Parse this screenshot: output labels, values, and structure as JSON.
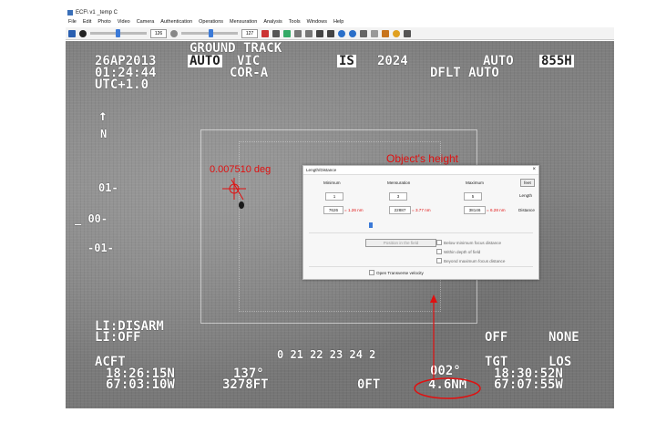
{
  "titlebar": {
    "title": "ECF\\ v1 _temp C"
  },
  "menu": [
    "File",
    "Edit",
    "Photo",
    "Video",
    "Camera",
    "Authentication",
    "Operations",
    "Mensuration",
    "Analysis",
    "Tools",
    "Windows",
    "Help"
  ],
  "toolbar": {
    "value_a": "126",
    "value_b": "127"
  },
  "hud": {
    "mode": "GROUND TRACK",
    "date": "26AP2013",
    "auto_box": "AUTO",
    "vic": "VIC",
    "corr": "COR-A",
    "is": "IS",
    "year": "2024",
    "time": "01:24:44",
    "utc": "UTC+1.0",
    "dflt_auto": "DFLT AUTO",
    "auto_right": "AUTO",
    "rate_box": "855H",
    "scale_top": "01-",
    "scale_mid": "_ 00-",
    "scale_bot": "-01-",
    "li_1": "LI:DISARM",
    "li_2": "LI:OFF",
    "off": "OFF",
    "none": "NONE",
    "acft": "ACFT",
    "acft_lat": "18:26:15N",
    "acft_lon": "67:03:10W",
    "heading": "137°",
    "alt": "3278FT",
    "oft": "0FT",
    "ticks": "0 21 22 23 24 2",
    "deg_small": "002°",
    "range": "4.6NM",
    "tgt": "TGT",
    "los": "LOS",
    "tgt_lat": "18:30:52N",
    "tgt_lon": "67:07:55W"
  },
  "annotations": {
    "angle": "0.007510 deg",
    "height": "Object's height"
  },
  "dialog": {
    "title": "Length/Distance",
    "close": "×",
    "col_min": "Minimum",
    "col_mens": "Mensuration",
    "col_max": "Maximum",
    "unit_btn": "feet",
    "len_label": "Length",
    "dist_label": "Distance",
    "min_len": "1",
    "mens_len": "3",
    "max_len": "5",
    "min_dist": "7626",
    "mens_dist": "22887",
    "max_dist": "38146",
    "min_nm": "= 1.26 nm",
    "mens_nm": "= 3.77 nm",
    "max_nm": "= 6.28 nm",
    "position_btn": "Position in the field",
    "chk_below": "Below minimum focus distance",
    "chk_within": "Within depth of field",
    "chk_beyond": "Beyond maximum focus distance",
    "open_transverse": "Open Transverse velocity"
  },
  "colors": {
    "annotation_red": "#e01010",
    "hud_white": "#ffffff",
    "dialog_bg": "#f7f7f7"
  }
}
